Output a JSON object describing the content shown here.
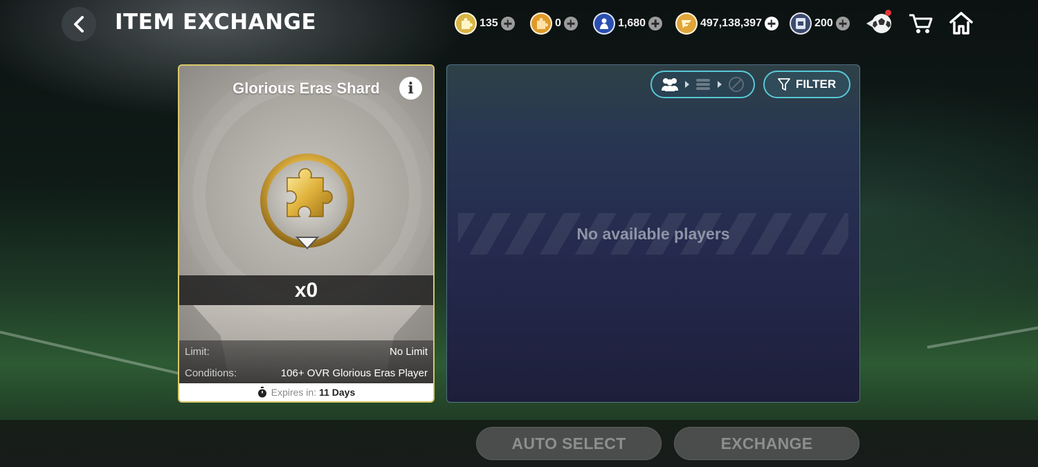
{
  "header": {
    "title": "ITEM EXCHANGE",
    "back_icon": "chevron-left-icon",
    "currencies": [
      {
        "name": "glorious-eras-shard",
        "value": "135",
        "icon": "puzzle-coin-icon",
        "color": "#d8b545"
      },
      {
        "name": "shard-orange",
        "value": "0",
        "icon": "puzzle-coin-orange-icon",
        "color": "#e09a2a"
      },
      {
        "name": "player-token",
        "value": "1,680",
        "icon": "player-token-icon",
        "color": "#2a4fb0"
      },
      {
        "name": "coins",
        "value": "497,138,397",
        "icon": "fc-coin-icon",
        "color": "#e0a63a"
      },
      {
        "name": "season-token",
        "value": "200",
        "icon": "season-token-icon",
        "color": "#3c4a6e"
      }
    ],
    "right_icons": [
      "football-icon",
      "cart-icon",
      "home-icon"
    ]
  },
  "item": {
    "title": "Glorious Eras Shard",
    "quantity": "x0",
    "limit_label": "Limit:",
    "limit_value": "No Limit",
    "conditions_label": "Conditions:",
    "conditions_value": "106+ OVR Glorious Eras Player",
    "expires_label": "Expires in:",
    "expires_value": "11 Days"
  },
  "panel": {
    "filter_label": "FILTER",
    "empty_text": "No available players"
  },
  "actions": {
    "auto_select": "AUTO SELECT",
    "exchange": "EXCHANGE"
  }
}
